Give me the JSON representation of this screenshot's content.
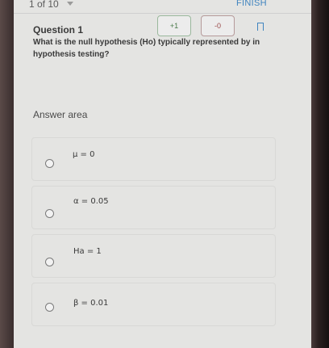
{
  "header": {
    "pager": "1 of 10",
    "finish_label": "FINISH"
  },
  "question": {
    "title": "Question 1",
    "plus_label": "+1",
    "minus_label": "-0",
    "text": "What is the null hypothesis (Ho) typically represented by in hypothesis testing?"
  },
  "answers": {
    "label": "Answer area",
    "options": [
      {
        "text": "μ = 0"
      },
      {
        "text": "α = 0.05"
      },
      {
        "text": "Ha = 1"
      },
      {
        "text": "β = 0.01"
      }
    ]
  },
  "colors": {
    "accent": "#3f84bf",
    "background": "#e4e4e2"
  }
}
